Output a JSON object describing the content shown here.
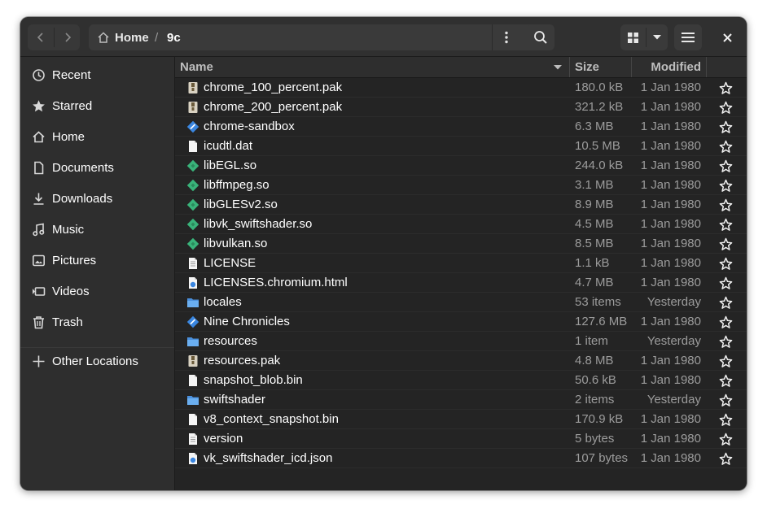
{
  "path": {
    "home": "Home",
    "separator": "/",
    "current": "9c"
  },
  "sidebar": {
    "items": [
      {
        "label": "Recent",
        "icon": "clock-icon"
      },
      {
        "label": "Starred",
        "icon": "star-icon"
      },
      {
        "label": "Home",
        "icon": "home-icon"
      },
      {
        "label": "Documents",
        "icon": "document-icon"
      },
      {
        "label": "Downloads",
        "icon": "download-icon"
      },
      {
        "label": "Music",
        "icon": "music-icon"
      },
      {
        "label": "Pictures",
        "icon": "picture-icon"
      },
      {
        "label": "Videos",
        "icon": "video-icon"
      },
      {
        "label": "Trash",
        "icon": "trash-icon"
      }
    ],
    "other": {
      "label": "Other Locations",
      "icon": "plus-icon"
    }
  },
  "columns": {
    "name": "Name",
    "size": "Size",
    "modified": "Modified"
  },
  "files": [
    {
      "name": "chrome_100_percent.pak",
      "size": "180.0 kB",
      "modified": "1 Jan 1980",
      "type": "archive"
    },
    {
      "name": "chrome_200_percent.pak",
      "size": "321.2 kB",
      "modified": "1 Jan 1980",
      "type": "archive"
    },
    {
      "name": "chrome-sandbox",
      "size": "6.3 MB",
      "modified": "1 Jan 1980",
      "type": "executable"
    },
    {
      "name": "icudtl.dat",
      "size": "10.5 MB",
      "modified": "1 Jan 1980",
      "type": "blank"
    },
    {
      "name": "libEGL.so",
      "size": "244.0 kB",
      "modified": "1 Jan 1980",
      "type": "library"
    },
    {
      "name": "libffmpeg.so",
      "size": "3.1 MB",
      "modified": "1 Jan 1980",
      "type": "library"
    },
    {
      "name": "libGLESv2.so",
      "size": "8.9 MB",
      "modified": "1 Jan 1980",
      "type": "library"
    },
    {
      "name": "libvk_swiftshader.so",
      "size": "4.5 MB",
      "modified": "1 Jan 1980",
      "type": "library"
    },
    {
      "name": "libvulkan.so",
      "size": "8.5 MB",
      "modified": "1 Jan 1980",
      "type": "library"
    },
    {
      "name": "LICENSE",
      "size": "1.1 kB",
      "modified": "1 Jan 1980",
      "type": "text"
    },
    {
      "name": "LICENSES.chromium.html",
      "size": "4.7 MB",
      "modified": "1 Jan 1980",
      "type": "html"
    },
    {
      "name": "locales",
      "size": "53 items",
      "modified": "Yesterday",
      "type": "folder"
    },
    {
      "name": "Nine Chronicles",
      "size": "127.6 MB",
      "modified": "1 Jan 1980",
      "type": "executable"
    },
    {
      "name": "resources",
      "size": "1 item",
      "modified": "Yesterday",
      "type": "folder"
    },
    {
      "name": "resources.pak",
      "size": "4.8 MB",
      "modified": "1 Jan 1980",
      "type": "archive"
    },
    {
      "name": "snapshot_blob.bin",
      "size": "50.6 kB",
      "modified": "1 Jan 1980",
      "type": "blank"
    },
    {
      "name": "swiftshader",
      "size": "2 items",
      "modified": "Yesterday",
      "type": "folder"
    },
    {
      "name": "v8_context_snapshot.bin",
      "size": "170.9 kB",
      "modified": "1 Jan 1980",
      "type": "blank"
    },
    {
      "name": "version",
      "size": "5 bytes",
      "modified": "1 Jan 1980",
      "type": "text"
    },
    {
      "name": "vk_swiftshader_icd.json",
      "size": "107 bytes",
      "modified": "1 Jan 1980",
      "type": "html"
    }
  ],
  "colors": {
    "window_bg": "#242424",
    "headerbar": "#303030",
    "sidebar": "#2e2e2e",
    "folder": "#5ea2e8",
    "library": "#39b37a",
    "executable": "#3a86e0"
  }
}
